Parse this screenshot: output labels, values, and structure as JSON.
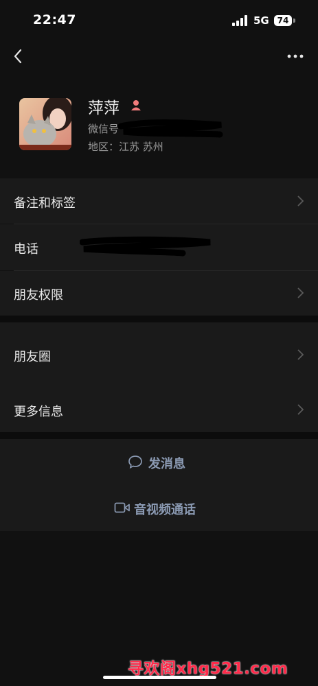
{
  "status_bar": {
    "time": "22:47",
    "network": "5G",
    "battery": "74"
  },
  "profile": {
    "name": "萍萍",
    "wechat_id_label": "微信号",
    "region": "地区：江苏 苏州"
  },
  "menu_group_1": {
    "items": [
      {
        "label": "备注和标签",
        "has_chevron": true
      },
      {
        "label": "电话",
        "has_chevron": false
      },
      {
        "label": "朋友权限",
        "has_chevron": true
      }
    ]
  },
  "menu_group_2": {
    "items": [
      {
        "label": "朋友圈",
        "has_chevron": true
      },
      {
        "label": "更多信息",
        "has_chevron": true
      }
    ]
  },
  "actions": {
    "send_message": "发消息",
    "av_call": "音视频通话"
  },
  "watermark": "寻欢阁xhg521.com",
  "colors": {
    "background": "#111111",
    "row_background": "#1a1a1a",
    "action_text": "#8b9ab3"
  }
}
